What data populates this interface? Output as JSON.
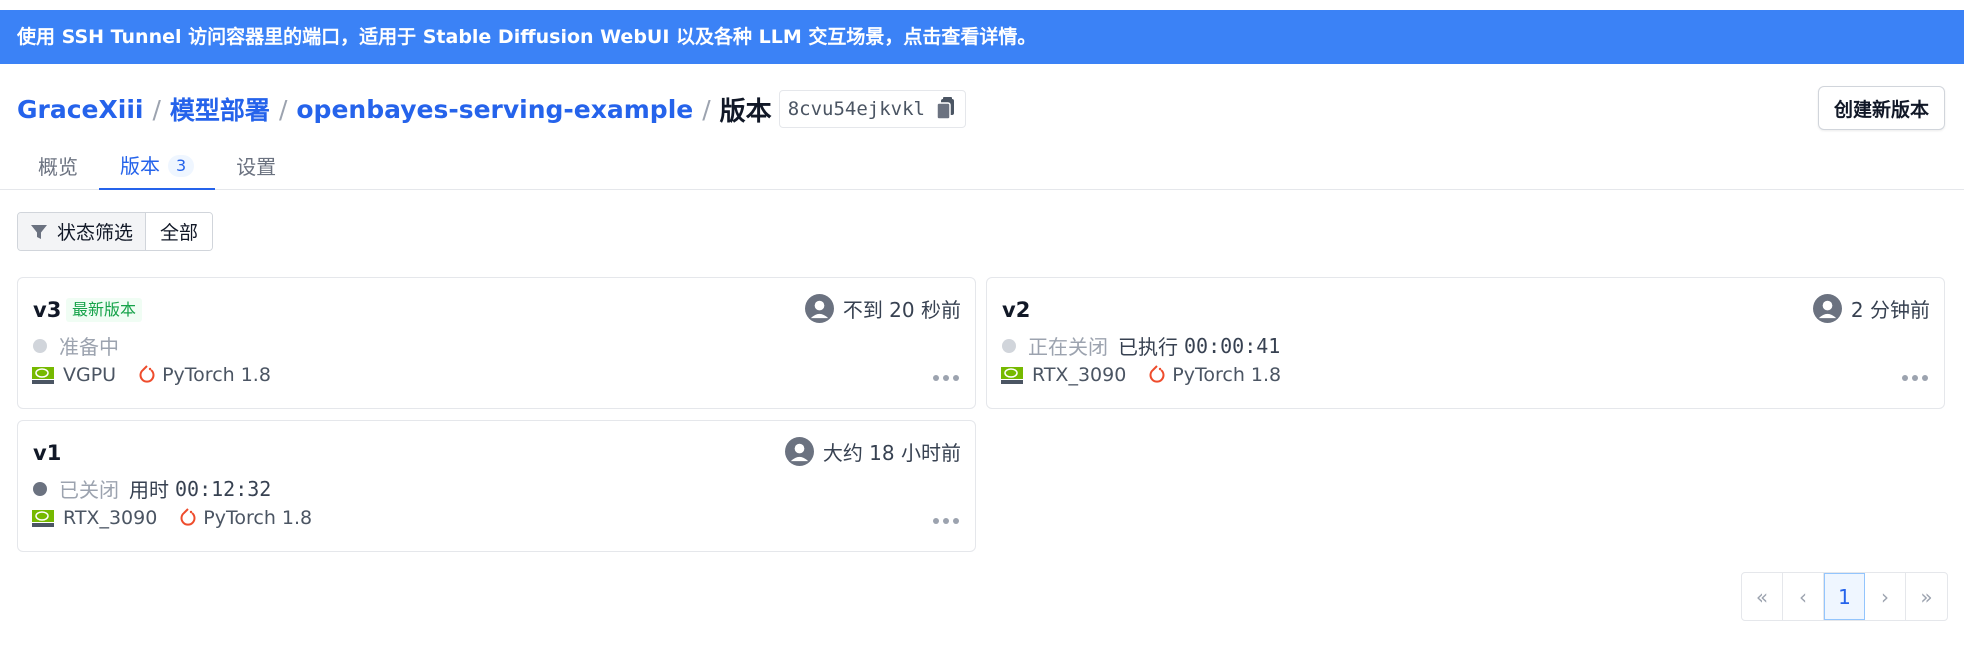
{
  "banner": {
    "text": "使用 SSH Tunnel 访问容器里的端口，适用于 Stable Diffusion WebUI 以及各种 LLM 交互场景，点击查看详情。"
  },
  "breadcrumb": {
    "user": "GraceXiii",
    "section": "模型部署",
    "project": "openbayes-serving-example",
    "current": "版本",
    "sep": "/",
    "hash": "8cvu54ejkvkl"
  },
  "header": {
    "new_version_label": "创建新版本"
  },
  "tabs": [
    {
      "label": "概览"
    },
    {
      "label": "版本",
      "badge": "3"
    },
    {
      "label": "设置"
    }
  ],
  "filter": {
    "label": "状态筛选",
    "value": "全部"
  },
  "versions": [
    {
      "name": "v3",
      "badge": "最新版本",
      "time": "不到 20 秒前",
      "status": "准备中",
      "status_color": "#d1d5db",
      "gpu": "VGPU",
      "framework": "PyTorch 1.8"
    },
    {
      "name": "v2",
      "time": "2 分钟前",
      "status": "正在关闭",
      "status_color": "#d1d5db",
      "duration_label": "已执行",
      "duration": "00:00:41",
      "gpu": "RTX_3090",
      "framework": "PyTorch 1.8"
    },
    {
      "name": "v1",
      "time": "大约 18 小时前",
      "status": "已关闭",
      "status_color": "#6b7280",
      "duration_label": "用时",
      "duration": "00:12:32",
      "gpu": "RTX_3090",
      "framework": "PyTorch 1.8"
    }
  ],
  "pagination": {
    "first": "«",
    "prev": "‹",
    "current": "1",
    "next": "›",
    "last": "»"
  },
  "colors": {
    "accent": "#2563eb",
    "banner": "#3b82f6",
    "latest_badge": "#16a34a",
    "pytorch": "#ee4c2c",
    "nvidia": "#76b900"
  },
  "icons": [
    "copy-icon",
    "filter-icon",
    "avatar-icon",
    "nvidia-icon",
    "pytorch-icon",
    "more-icon"
  ]
}
